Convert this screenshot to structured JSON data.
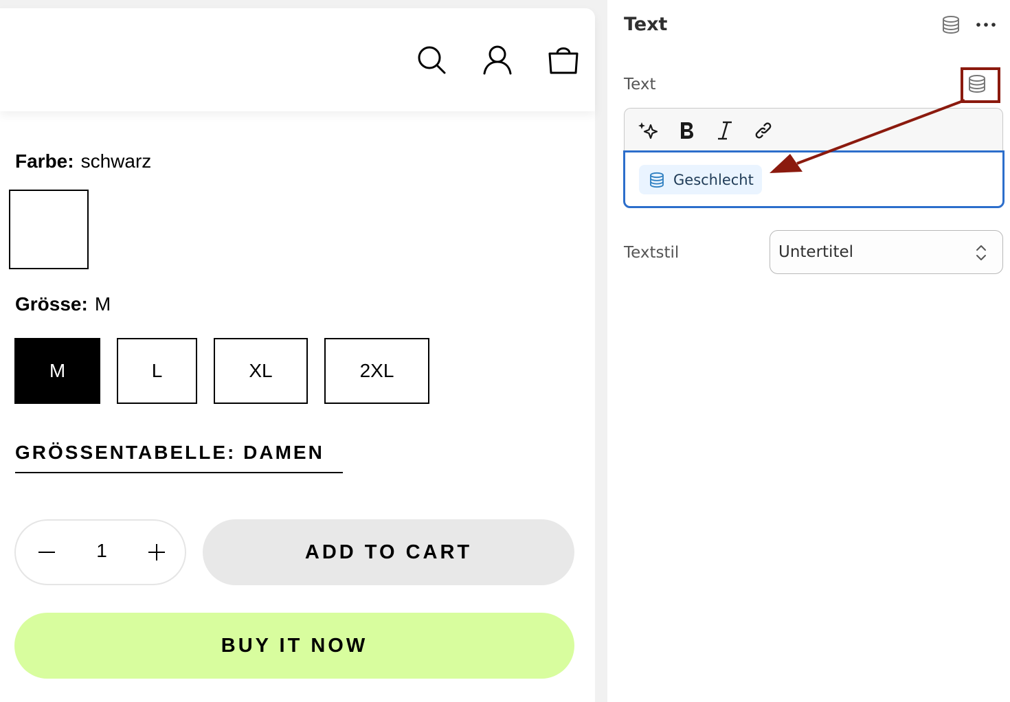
{
  "header": {
    "icons": [
      "search-icon",
      "account-icon",
      "cart-bag-icon"
    ]
  },
  "product": {
    "color_label": "Farbe:",
    "color_value": "schwarz",
    "size_label": "Grösse:",
    "size_value": "M",
    "sizes": [
      "M",
      "L",
      "XL",
      "2XL"
    ],
    "selected_size": "M",
    "size_chart_link": "GRÖSSENTABELLE: DAMEN",
    "quantity": "1",
    "add_to_cart": "ADD TO CART",
    "buy_now": "BUY IT NOW"
  },
  "panel": {
    "title": "Text",
    "text_label": "Text",
    "editor_toolbar": [
      "magic-icon",
      "bold-icon",
      "italic-icon",
      "link-icon"
    ],
    "dynamic_source_chip": "Geschlecht",
    "textstyle_label": "Textstil",
    "textstyle_value": "Untertitel"
  },
  "colors": {
    "buy_now_bg": "#d8fd9e",
    "add_to_cart_bg": "#e8e8e8",
    "editor_focus": "#2c6ecb",
    "annotation": "#8b1a0e",
    "chip_bg": "#eaf4ff"
  }
}
